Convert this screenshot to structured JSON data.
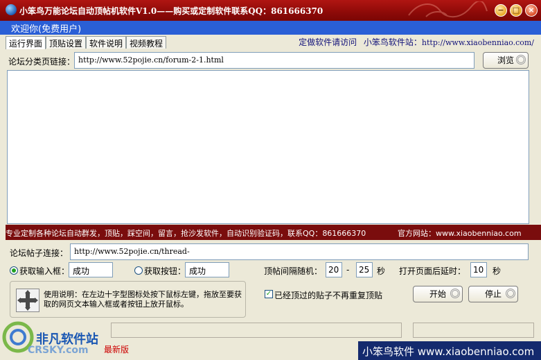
{
  "window": {
    "title": "小笨鸟万能论坛自动顶帖机软件V1.0——购买或定制软件联系QQ：861666370",
    "min_glyph": "−",
    "max_glyph": "□",
    "close_glyph": "×"
  },
  "welcome": "欢迎你(免费用户)",
  "tabs": [
    "运行界面",
    "顶贴设置",
    "软件说明",
    "视频教程"
  ],
  "header_links": {
    "custom": "定做软件请访问",
    "site_label": "小笨鸟软件站：",
    "site_url": "http://www.xiaobenniao.com/"
  },
  "forum_page": {
    "label": "论坛分类页链接：",
    "value": "http://www.52pojie.cn/forum-2-1.html",
    "browse_label": "浏览"
  },
  "log_text": "",
  "banner": {
    "left": "专业定制各种论坛自动群发，顶贴，踩空间，留言，抢沙发软件，自动识别验证码，联系QQ：861666370",
    "right": "官方网站：www.xiaobenniao.com"
  },
  "thread_link": {
    "label": "论坛帖子连接：",
    "value": "http://www.52pojie.cn/thread-"
  },
  "get_input": {
    "label": "获取输入框：",
    "value": "成功",
    "selected": true
  },
  "get_button": {
    "label": "获取按钮：",
    "value": "成功",
    "selected": false
  },
  "interval": {
    "label": "顶帖间隔随机：",
    "min": "20",
    "dash": "-",
    "max": "25",
    "unit": "秒"
  },
  "delay": {
    "label": "打开页面后延时：",
    "value": "10",
    "unit": "秒"
  },
  "instructions": "使用说明：在左边十字型图标处按下鼠标左键，拖放至要获取的网页文本输入框或者按钮上放开鼠标。",
  "no_repeat": {
    "label": "已经顶过的贴子不再重复顶贴",
    "checked": true
  },
  "start_label": "开始",
  "stop_label": "停止",
  "watermark": {
    "title": "非凡软件站",
    "sub": "CRSKY.com"
  },
  "new_version": "最新版",
  "brand_bar": "小笨鸟软件 www.xiaobenniao.com",
  "colors": {
    "title_bg": "#8d0a08",
    "welcome_bg": "#2a5fd6",
    "banner_bg": "#7a0d0d",
    "brand_bg": "#142a6e"
  }
}
